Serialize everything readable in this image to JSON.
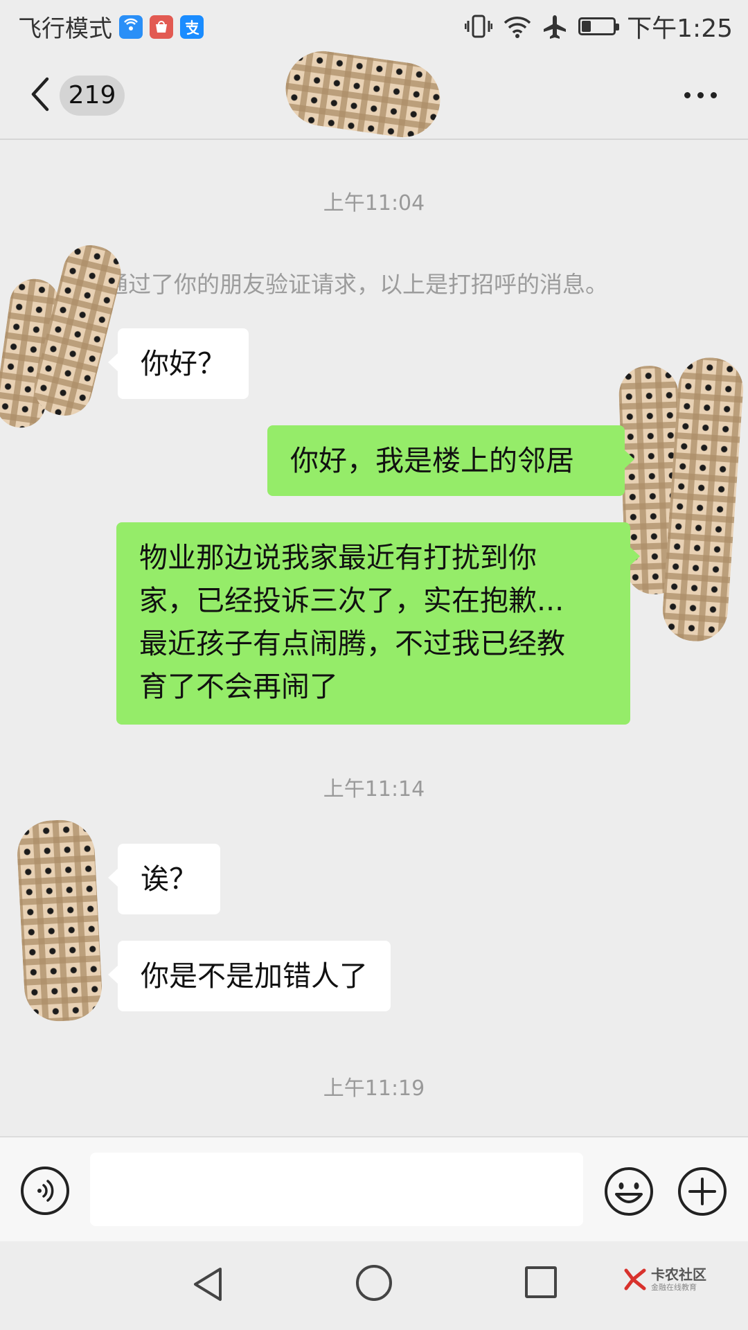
{
  "status_bar": {
    "left_text": "飞行模式",
    "app_icons": [
      {
        "name": "wifi-hotspot-app-icon",
        "color": "#2a8ff7",
        "glyph": "((•))"
      },
      {
        "name": "huawei-store-app-icon",
        "color": "#e25a52",
        "glyph": "≋"
      },
      {
        "name": "alipay-app-icon",
        "color": "#1a8cff",
        "glyph": "支"
      }
    ],
    "time": "下午1:25",
    "battery_level": 0.3
  },
  "header": {
    "unread_count": "219",
    "contact_name_masked": true
  },
  "messages": [
    {
      "type": "timestamp",
      "text": "上午11:04"
    },
    {
      "type": "system",
      "text": "通过了你的朋友验证请求，以上是打招呼的消息。"
    },
    {
      "type": "incoming",
      "text": "你好？"
    },
    {
      "type": "outgoing",
      "text": "你好，我是楼上的邻居"
    },
    {
      "type": "outgoing",
      "lines": [
        "物业那边说我家最近有打扰到你",
        "家，已经投诉三次了，实在抱歉...",
        "最近孩子有点闹腾，不过我已经教",
        "育了不会再闹了"
      ]
    },
    {
      "type": "timestamp",
      "text": "上午11:14"
    },
    {
      "type": "incoming",
      "text": "诶？"
    },
    {
      "type": "incoming",
      "text": "你是不是加错人了"
    },
    {
      "type": "timestamp",
      "text": "上午11:19"
    }
  ],
  "input_bar": {
    "value": "",
    "placeholder": ""
  },
  "watermark": {
    "title": "卡农社区",
    "subtitle": "金融在线教育",
    "color": "#d8322d"
  },
  "colors": {
    "outgoing_bubble": "#95ec69",
    "incoming_bubble": "#ffffff",
    "chat_background": "#ededed"
  }
}
